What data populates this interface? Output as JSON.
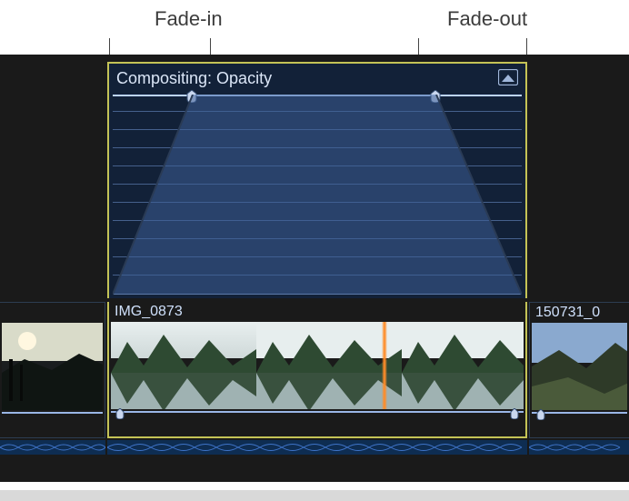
{
  "callouts": {
    "fade_in": "Fade-in",
    "fade_out": "Fade-out"
  },
  "animation_panel": {
    "title": "Compositing: Opacity",
    "title_icon": "title-overlay-icon",
    "keyframe_left_name": "fade-in-end-keyframe",
    "keyframe_right_name": "fade-out-start-keyframe"
  },
  "clips": {
    "selected": {
      "name": "IMG_0873"
    },
    "next": {
      "name": "150731_0"
    }
  }
}
